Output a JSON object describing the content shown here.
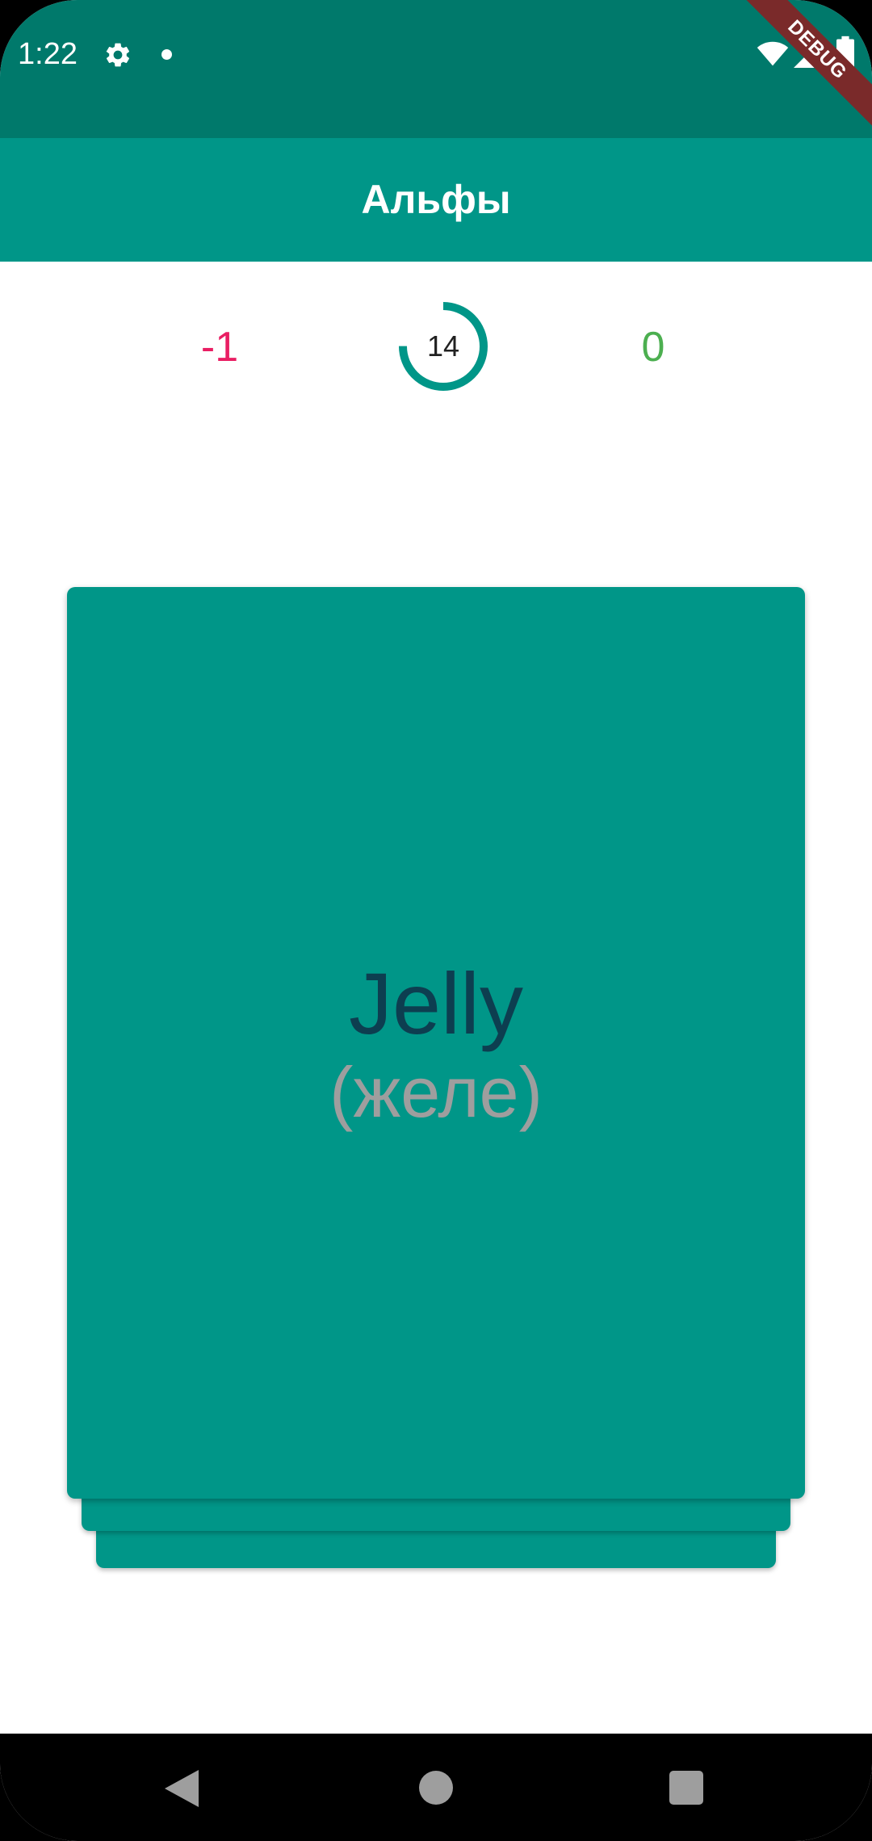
{
  "status_bar": {
    "time": "1:22",
    "icons": [
      "gear-icon",
      "notification-dot-icon",
      "wifi-icon",
      "signal-icon",
      "battery-icon"
    ],
    "background_color": "#00796b"
  },
  "debug_ribbon": {
    "label": "DEBUG"
  },
  "app_bar": {
    "title": "Альфы",
    "background_color": "#009688"
  },
  "scores": {
    "wrong": "-1",
    "remaining": "14",
    "right": "0",
    "wrong_color": "#e91e63",
    "right_color": "#4caf50",
    "progress_fraction": 0.75
  },
  "card": {
    "word": "Jelly",
    "translation": "(желе)",
    "background_color": "#009688",
    "word_color": "#0d3e50",
    "translation_color": "#9e9e9e"
  },
  "nav_bar": {
    "icons": [
      "back-icon",
      "home-icon",
      "recents-icon"
    ]
  }
}
